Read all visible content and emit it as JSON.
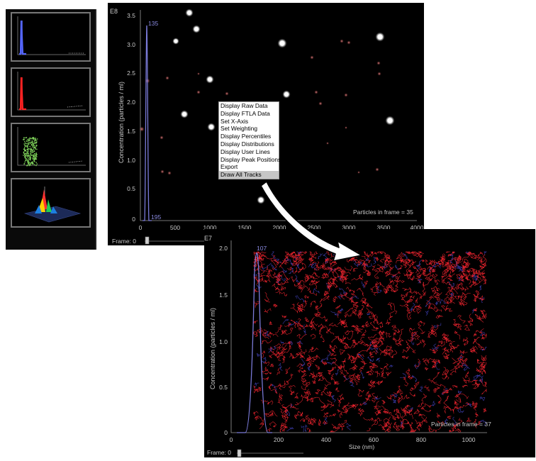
{
  "panel1": {
    "exponent": "E8",
    "y_label": "Concentration (particles / ml)",
    "y_ticks": [
      "3.5",
      "3.0",
      "2.5",
      "2.0",
      "1.5",
      "1.0",
      "0.5",
      "0"
    ],
    "x_ticks": [
      "0",
      "500",
      "1000",
      "1500",
      "2000",
      "2500",
      "3000",
      "3500",
      "4000"
    ],
    "peak_label": "135",
    "peak_foot_label": "195",
    "particles_text": "Particles in frame = 35",
    "frame_label": "Frame: 0"
  },
  "panel2": {
    "exponent": "E7",
    "y_label": "Concentration (particles / ml)",
    "y_ticks": [
      "2.0",
      "1.5",
      "1.0",
      "0.5",
      "0"
    ],
    "x_ticks": [
      "0",
      "200",
      "400",
      "600",
      "800",
      "1000"
    ],
    "x_label": "Size (nm)",
    "peak_label": "107",
    "particles_text": "Particles in frame = 37",
    "frame_label": "Frame: 0"
  },
  "context_menu": {
    "items": [
      "Display Raw Data",
      "Display FTLA Data",
      "Set X-Axis",
      "Set Weighting",
      "Display Percentiles",
      "Display Distributions",
      "Display User Lines",
      "Display Peak Positions",
      "Export",
      "Draw All Tracks"
    ],
    "selected_index": 9
  },
  "colors": {
    "background": "#000000",
    "axis": "#9a9a9a",
    "text": "#c8c8c8",
    "curve": "#7a7ad8",
    "tracks_red": "#e8232d",
    "tracks_blue": "#3b3ba8",
    "thumb_blue": "#5566ff",
    "thumb_red": "#ff2222",
    "thumb_green": "#7fd35a"
  }
}
